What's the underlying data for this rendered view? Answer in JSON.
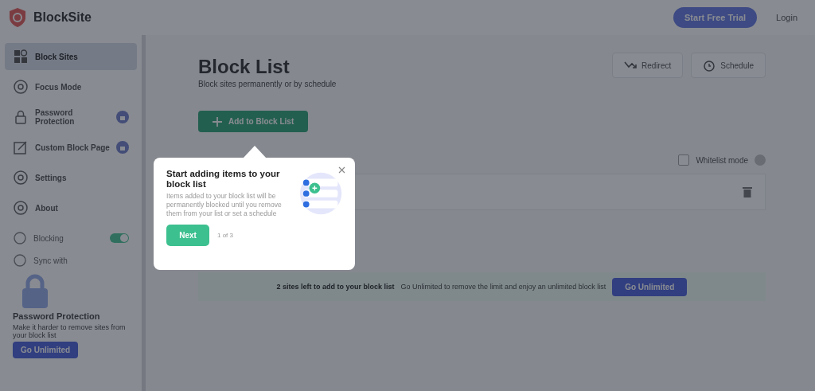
{
  "header": {
    "brand": "BlockSite",
    "trial_button": "Start Free Trial",
    "login": "Login"
  },
  "sidebar": {
    "items": [
      {
        "label": "Block Sites",
        "selected": true,
        "premium": false
      },
      {
        "label": "Focus Mode",
        "selected": false,
        "premium": false
      },
      {
        "label": "Password Protection",
        "selected": false,
        "premium": true
      },
      {
        "label": "Custom Block Page",
        "selected": false,
        "premium": true
      },
      {
        "label": "Settings",
        "selected": false,
        "premium": false
      },
      {
        "label": "About",
        "selected": false,
        "premium": false
      }
    ],
    "toggles": [
      {
        "label": "Blocking",
        "kind": "switch",
        "on": true
      },
      {
        "label": "Sync with",
        "kind": "plain"
      }
    ],
    "promo": {
      "title": "Password Protection",
      "text": "Make it harder to remove sites from your block list",
      "button": "Go Unlimited"
    }
  },
  "main": {
    "title": "Block List",
    "subtitle": "Block sites permanently or by schedule",
    "actions": [
      {
        "label": "Redirect"
      },
      {
        "label": "Schedule"
      }
    ],
    "add_button": "Add to Block List",
    "whitelist": {
      "label": "Whitelist mode",
      "checked": false
    },
    "banner": {
      "count_text": "2 sites left to add to your block list",
      "text": "Go Unlimited to remove the limit and enjoy an unlimited block list",
      "button": "Go Unlimited"
    }
  },
  "tour": {
    "title": "Start adding items to your block list",
    "text": "Items added to your block list will be permanently blocked until you remove them from your list or set a schedule",
    "next": "Next",
    "step": "1 of 3"
  }
}
